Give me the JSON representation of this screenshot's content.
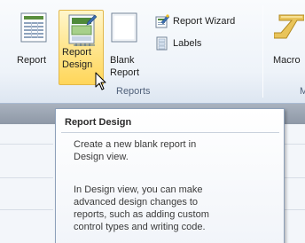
{
  "ribbon": {
    "report_label": "Report",
    "report_design_label_1": "Report",
    "report_design_label_2": "Design",
    "blank_report_label_1": "Blank",
    "blank_report_label_2": "Report",
    "report_wizard_label": "Report Wizard",
    "labels_label": "Labels",
    "macro_label": "Macro",
    "reports_group_label": "Reports",
    "next_group_label": "M"
  },
  "tooltip": {
    "title": "Report Design",
    "description_lines": [
      "Create a new blank report in",
      "Design view."
    ],
    "detail_lines": [
      "In Design view, you can make",
      "advanced design changes to",
      "reports, such as adding custom",
      "control types and writing code."
    ]
  }
}
